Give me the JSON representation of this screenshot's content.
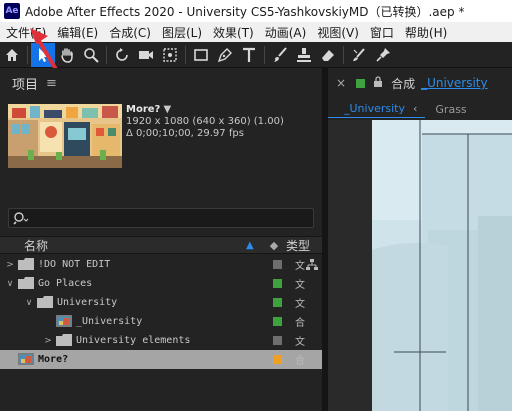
{
  "window": {
    "logo": "Ae",
    "title": "Adobe After Effects 2020 - University CS5-YashkovskiyMD（已转换）.aep *"
  },
  "menu": [
    {
      "label": "文件(F)"
    },
    {
      "label": "编辑(E)"
    },
    {
      "label": "合成(C)"
    },
    {
      "label": "图层(L)"
    },
    {
      "label": "效果(T)"
    },
    {
      "label": "动画(A)"
    },
    {
      "label": "视图(V)"
    },
    {
      "label": "窗口"
    },
    {
      "label": "帮助(H)"
    }
  ],
  "toolbar": {
    "tools": [
      "home-icon",
      "selection-tool-icon",
      "hand-tool-icon",
      "zoom-tool-icon",
      "rotate-tool-icon",
      "camera-tool-icon",
      "pan-behind-tool-icon",
      "rectangle-tool-icon",
      "pen-tool-icon",
      "type-tool-icon",
      "brush-tool-icon",
      "clone-stamp-tool-icon",
      "eraser-tool-icon",
      "roto-brush-tool-icon",
      "puppet-pin-tool-icon"
    ],
    "selected": "selection-tool-icon"
  },
  "project": {
    "title": "项目",
    "menu_icon": "≡",
    "preview": {
      "name": "More?",
      "dims": "1920 x 1080  (640 x 360) (1.00)",
      "duration": "Δ 0;00;10;00, 29.97 fps"
    },
    "search_placeholder": "",
    "columns": {
      "name": "名称",
      "type": "类型"
    },
    "items": [
      {
        "name": "!DO NOT EDIT",
        "kind": "folder",
        "indent": 0,
        "expanded": false,
        "label_color": "#6e6e6e",
        "type_glyph": "文"
      },
      {
        "name": "Go Places",
        "kind": "folder",
        "indent": 0,
        "expanded": true,
        "label_color": "#3ea33e",
        "type_glyph": "文"
      },
      {
        "name": "University",
        "kind": "folder",
        "indent": 1,
        "expanded": true,
        "label_color": "#3ea33e",
        "type_glyph": "文"
      },
      {
        "name": "_University",
        "kind": "comp",
        "indent": 2,
        "expanded": null,
        "label_color": "#3ea33e",
        "type_glyph": "合"
      },
      {
        "name": "University elements",
        "kind": "folder",
        "indent": 2,
        "expanded": false,
        "label_color": "#6e6e6e",
        "type_glyph": "文"
      },
      {
        "name": "More?",
        "kind": "comp",
        "indent": 0,
        "expanded": null,
        "label_color": "#f0a020",
        "type_glyph": "合",
        "selected": true
      }
    ]
  },
  "composition": {
    "close": "×",
    "lock": "🔒",
    "label": "合成",
    "name": "_University",
    "tabs": [
      {
        "label": "_University",
        "active": true
      },
      {
        "label": "Grass",
        "active": false
      }
    ]
  }
}
